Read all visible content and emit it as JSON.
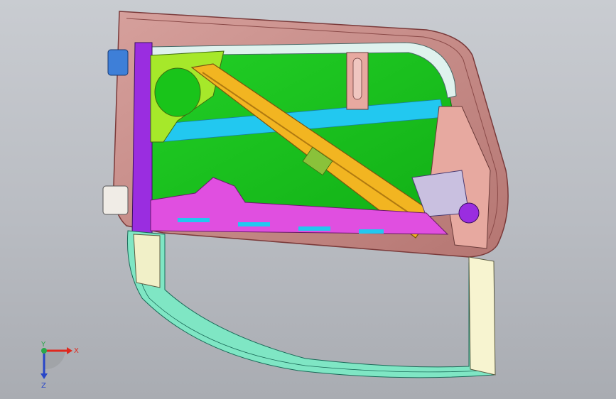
{
  "viewport": {
    "background_top": "#c9ccd1",
    "background_bottom": "#a9acb2"
  },
  "colors": {
    "outer_panel": "#c48a88",
    "outer_panel_edge": "#7a3a3a",
    "glass": "#19c41a",
    "glass_band": "#22c8f0",
    "frame_pink": "#e7a9a0",
    "frame_cyan": "#dff2ee",
    "magenta": "#e04fe0",
    "purple": "#9a2de0",
    "yellow_beam": "#f2b521",
    "yellow_green_bracket": "#a6e82a",
    "window_frame": "#7fe6c4",
    "cream_post": "#f7f4d0",
    "hinge_blue": "#3e7fd8"
  },
  "triad": {
    "x_label": "X",
    "y_label": "Y",
    "z_label": "Z",
    "x_color": "#e0281e",
    "y_color": "#2aa84a",
    "z_color": "#2846c8"
  }
}
